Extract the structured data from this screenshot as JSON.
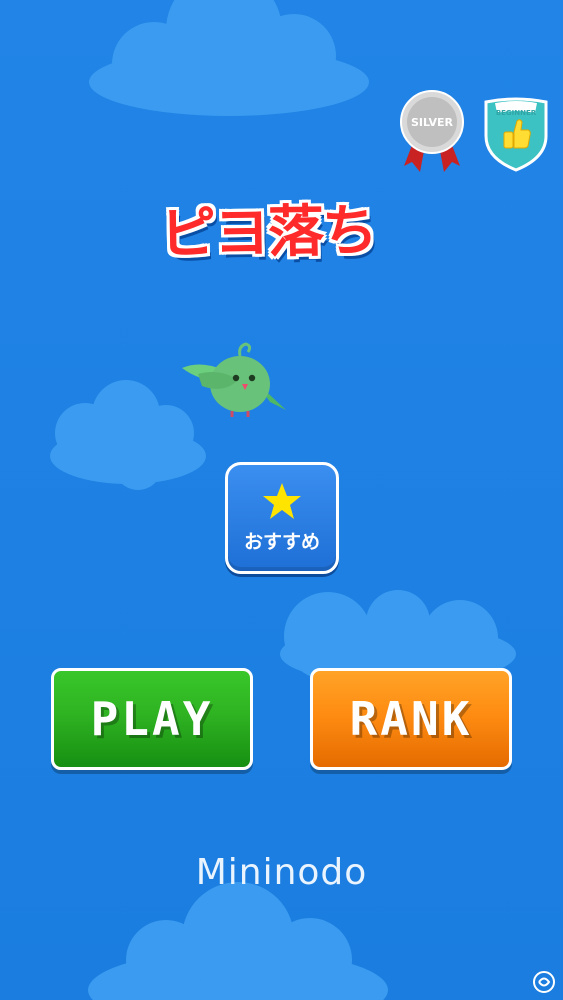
{
  "app": {
    "title": "ピヨ落ち",
    "developer": "Mininodo"
  },
  "badges": {
    "silver": {
      "text": "SILVER",
      "icon": "silver-medal-icon"
    },
    "beginner": {
      "text": "BEGINNER",
      "icon": "thumbs-up-shield-icon"
    }
  },
  "recommend": {
    "label": "おすすめ",
    "icon": "star-icon"
  },
  "buttons": {
    "play_label": "PLAY",
    "rank_label": "RANK"
  },
  "colors": {
    "background": "#1f7fe0",
    "cloud": "#3a9bf0",
    "title": "#ff2a2a",
    "play": "#2fb322",
    "rank": "#ff8c12",
    "star": "#ffe400"
  }
}
